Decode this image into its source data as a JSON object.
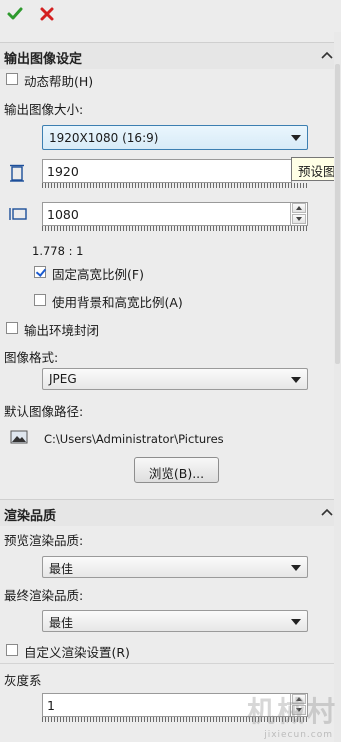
{
  "toolbar": {
    "ok_icon": "checkmark-icon",
    "cancel_icon": "close-x-icon"
  },
  "output_section": {
    "title": "输出图像设定",
    "dynamic_help": {
      "label": "动态帮助(H)",
      "checked": false
    },
    "image_size_label": "输出图像大小:",
    "size_select": "1920X1080  (16:9)",
    "width_value": "1920",
    "height_value": "1080",
    "ratio": "1.778 : 1",
    "fixed_ratio": {
      "label": "固定高宽比例(F)",
      "checked": true
    },
    "bg_ratio": {
      "label": "使用背景和高宽比例(A)",
      "checked": false
    },
    "tooltip": "预设图",
    "output_env": {
      "label": "输出环境封闭",
      "checked": false
    },
    "format_label": "图像格式:",
    "format_select": "JPEG",
    "path_label": "默认图像路径:",
    "path_value": "C:\\Users\\Administrator\\Pictures",
    "browse_button": "浏览(B)..."
  },
  "render_section": {
    "title": "渲染品质",
    "preview_label": "预览渲染品质:",
    "preview_select": "最佳",
    "final_label": "最终渲染品质:",
    "final_select": "最佳",
    "custom_render": {
      "label": "自定义渲染设置(R)",
      "checked": false
    },
    "gamma_label": "灰度系",
    "gamma_value": "1"
  },
  "watermark": {
    "main": "机械村",
    "sub": "jixiecun.com"
  },
  "colors": {
    "accent_check": "#2e9a2e",
    "accent_close": "#d42020",
    "select_active_border": "#3c7fb1"
  }
}
